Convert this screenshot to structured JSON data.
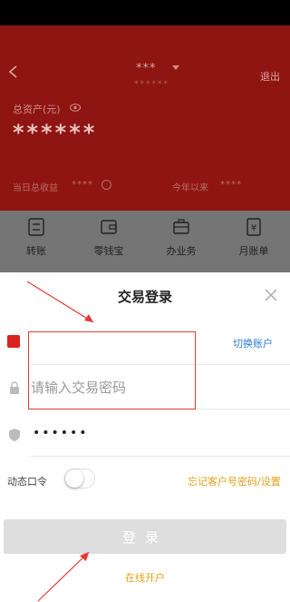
{
  "account": {
    "title": "***",
    "subtitle": "******",
    "logout": "退出",
    "total_label": "总资产(元)",
    "total_value": "******",
    "profit_label": "当日总收益",
    "profit_value": "****",
    "year_label": "今年以来",
    "year_value": "****"
  },
  "menu": [
    {
      "label": "转账",
      "icon": "transfer-icon"
    },
    {
      "label": "零钱宝",
      "icon": "wallet-icon"
    },
    {
      "label": "办业务",
      "icon": "briefcase-icon"
    },
    {
      "label": "月账单",
      "icon": "bill-icon"
    }
  ],
  "login": {
    "title": "交易登录",
    "switch_account": "切换账户",
    "password_placeholder": "请输入交易密码",
    "verify_code_masked": "••••••",
    "dynamic_token_label": "动态口令",
    "forgot_link": "忘记客户号密码/设置",
    "login_button": "登录",
    "open_account": "在线开户"
  },
  "colors": {
    "header_red": "#8f1512",
    "link_blue": "#2a7bd4",
    "link_orange": "#e1a01d",
    "annotation_red": "#e53935"
  }
}
